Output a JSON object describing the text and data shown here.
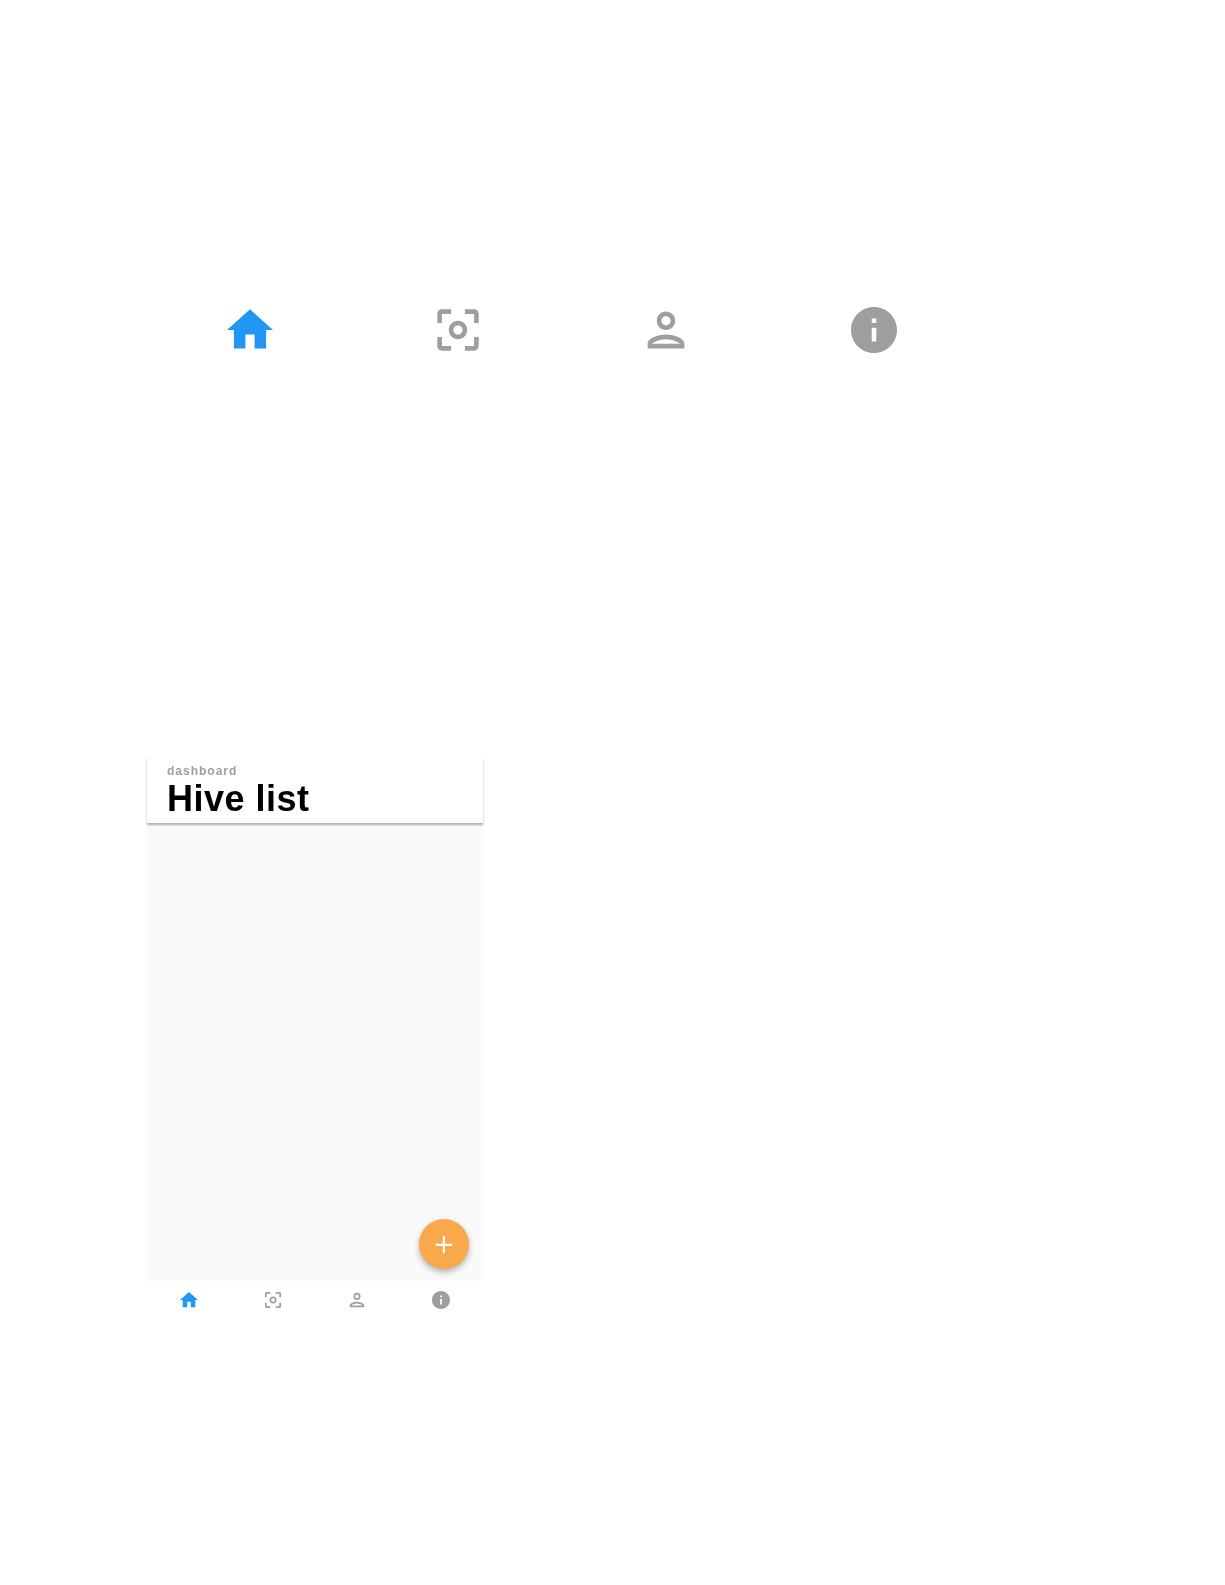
{
  "large_nav": {
    "items": [
      {
        "kind": "home",
        "selected": true
      },
      {
        "kind": "scan",
        "selected": false
      },
      {
        "kind": "person",
        "selected": false
      },
      {
        "kind": "info",
        "selected": false
      }
    ]
  },
  "phone": {
    "header": {
      "subtitle": "dashboard",
      "title": "Hive list"
    },
    "fab": {
      "label": "+"
    },
    "bottom_nav": {
      "items": [
        {
          "kind": "home",
          "selected": true
        },
        {
          "kind": "scan",
          "selected": false
        },
        {
          "kind": "person",
          "selected": false
        },
        {
          "kind": "info",
          "selected": false
        }
      ]
    }
  }
}
